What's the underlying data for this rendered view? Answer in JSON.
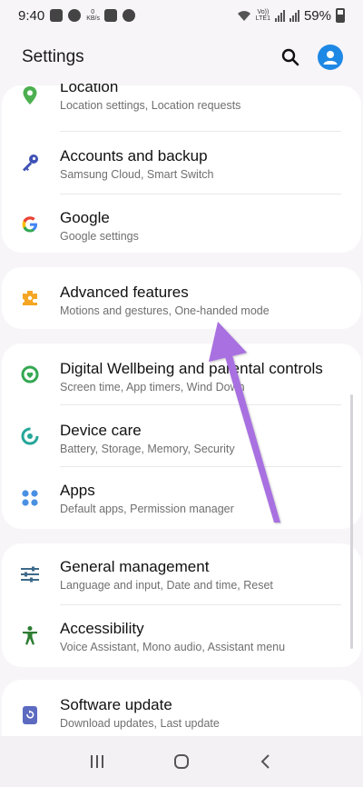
{
  "status_bar": {
    "time": "9:40",
    "kbs": "0\nKB/s",
    "network_label": "VoLTE1 LTE1",
    "battery_percent": "59%"
  },
  "header": {
    "title": "Settings"
  },
  "groups": [
    {
      "items": [
        {
          "icon": "location-icon",
          "title": "Location",
          "subtitle": "Location settings, Location requests",
          "color": "#4caf50"
        },
        {
          "icon": "key-icon",
          "title": "Accounts and backup",
          "subtitle": "Samsung Cloud, Smart Switch",
          "color": "#3f51b5"
        },
        {
          "icon": "google-icon",
          "title": "Google",
          "subtitle": "Google settings",
          "color": "#4285f4"
        }
      ]
    },
    {
      "items": [
        {
          "icon": "puzzle-icon",
          "title": "Advanced features",
          "subtitle": "Motions and gestures, One-handed mode",
          "color": "#f5a623"
        }
      ]
    },
    {
      "items": [
        {
          "icon": "wellbeing-icon",
          "title": "Digital Wellbeing and parental controls",
          "subtitle": "Screen time, App timers, Wind Down",
          "color": "#34a853"
        },
        {
          "icon": "device-care-icon",
          "title": "Device care",
          "subtitle": "Battery, Storage, Memory, Security",
          "color": "#26a69a"
        },
        {
          "icon": "apps-icon",
          "title": "Apps",
          "subtitle": "Default apps, Permission manager",
          "color": "#4a90e2"
        }
      ]
    },
    {
      "items": [
        {
          "icon": "sliders-icon",
          "title": "General management",
          "subtitle": "Language and input, Date and time, Reset",
          "color": "#3d6a8a"
        },
        {
          "icon": "accessibility-icon",
          "title": "Accessibility",
          "subtitle": "Voice Assistant, Mono audio, Assistant menu",
          "color": "#2e7d32"
        }
      ]
    },
    {
      "items": [
        {
          "icon": "software-update-icon",
          "title": "Software update",
          "subtitle": "Download updates, Last update",
          "color": "#5c6bc0"
        }
      ]
    }
  ],
  "colors": {
    "background": "#f7f5f8",
    "card": "#ffffff",
    "accent_avatar": "#1e88e5",
    "annotation_arrow": "#a86fe0"
  }
}
